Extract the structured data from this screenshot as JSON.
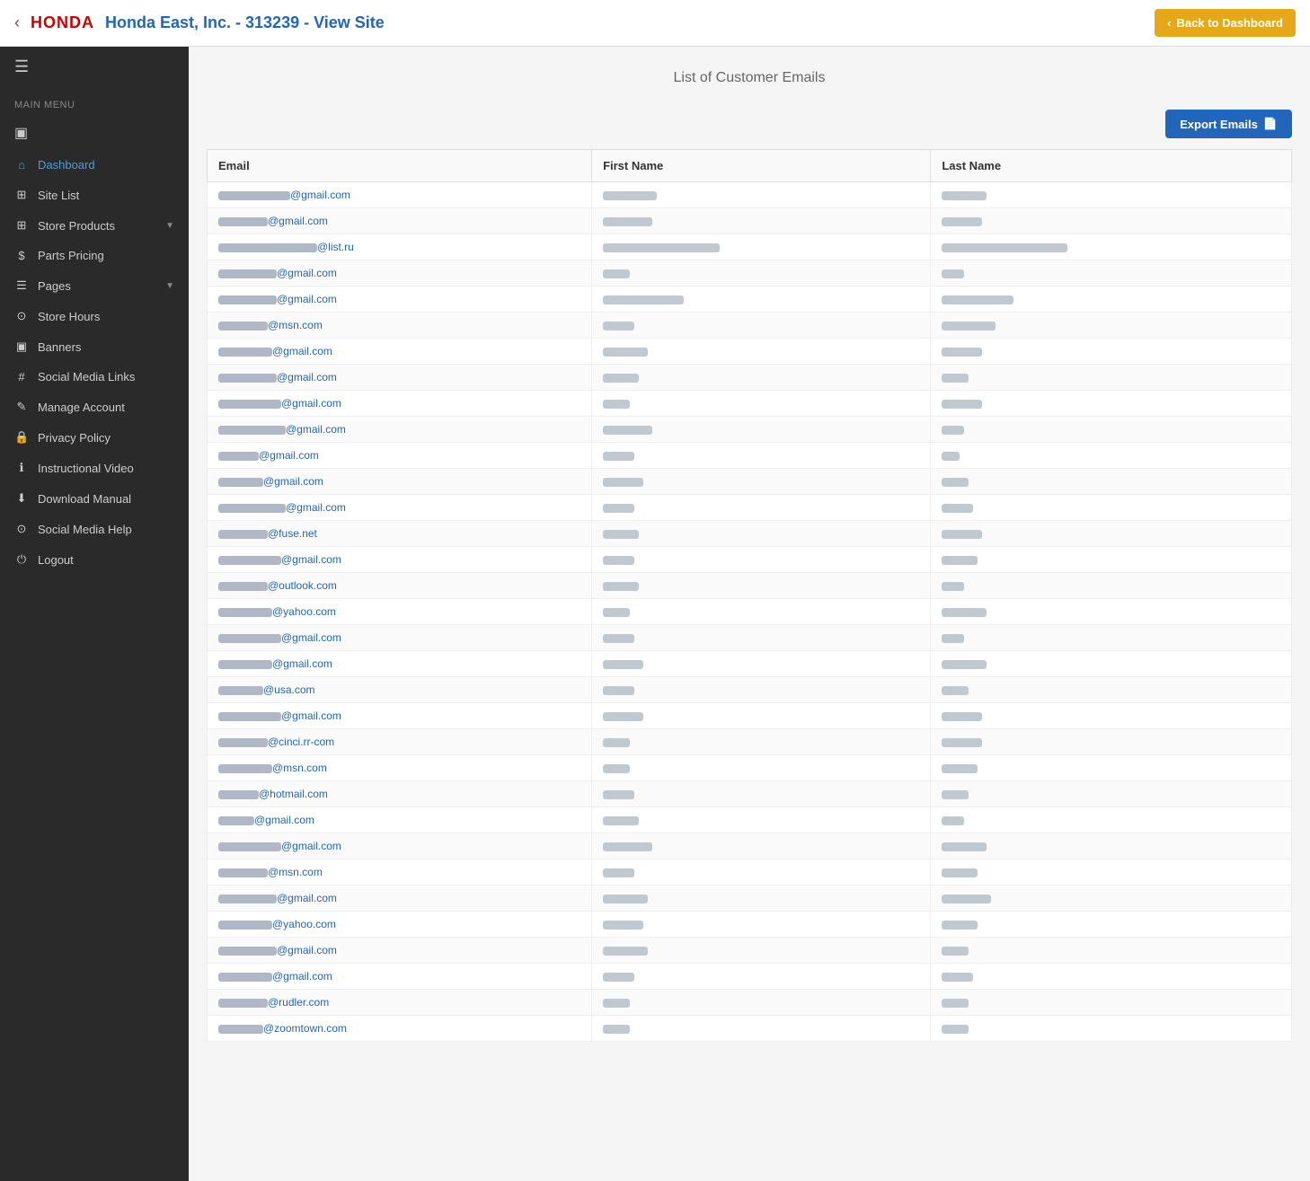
{
  "header": {
    "close_label": "‹",
    "honda_label": "HONDA",
    "site_title": "Honda East, Inc. - 313239 - View Site",
    "back_button": "Back to Dashboard"
  },
  "sidebar": {
    "menu_label": "Main Menu",
    "hamburger_icon": "☰",
    "monitor_icon": "▣",
    "items": [
      {
        "id": "dashboard",
        "label": "Dashboard",
        "icon": "⌂",
        "active": true
      },
      {
        "id": "site-list",
        "label": "Site List",
        "icon": "⊞",
        "active": false
      },
      {
        "id": "store-products",
        "label": "Store Products",
        "icon": "⊞",
        "active": false,
        "chevron": true
      },
      {
        "id": "parts-pricing",
        "label": "Parts Pricing",
        "icon": "$",
        "active": false
      },
      {
        "id": "pages",
        "label": "Pages",
        "icon": "☰",
        "active": false,
        "chevron": true
      },
      {
        "id": "store-hours",
        "label": "Store Hours",
        "icon": "⊙",
        "active": false
      },
      {
        "id": "banners",
        "label": "Banners",
        "icon": "▣",
        "active": false
      },
      {
        "id": "social-media-links",
        "label": "Social Media Links",
        "icon": "#",
        "active": false
      },
      {
        "id": "manage-account",
        "label": "Manage Account",
        "icon": "✎",
        "active": false
      },
      {
        "id": "privacy-policy",
        "label": "Privacy Policy",
        "icon": "🔒",
        "active": false
      },
      {
        "id": "instructional-video",
        "label": "Instructional Video",
        "icon": "ℹ",
        "active": false
      },
      {
        "id": "download-manual",
        "label": "Download Manual",
        "icon": "⬇",
        "active": false
      },
      {
        "id": "social-media-help",
        "label": "Social Media Help",
        "icon": "⊙",
        "active": false
      },
      {
        "id": "logout",
        "label": "Logout",
        "icon": "⏻",
        "active": false
      }
    ]
  },
  "main": {
    "page_title": "List of Customer Emails",
    "export_button": "Export Emails",
    "table": {
      "columns": [
        "Email",
        "First Name",
        "Last Name"
      ],
      "rows": [
        {
          "email": "@gmail.com",
          "email_prefix_width": "80",
          "first_name_width": "60",
          "last_name_width": "50"
        },
        {
          "email": "@gmail.com",
          "email_prefix_width": "55",
          "first_name_width": "55",
          "last_name_width": "45"
        },
        {
          "email": "@list.ru",
          "email_prefix_width": "110",
          "first_name_width": "130",
          "last_name_width": "140"
        },
        {
          "email": "@gmail.com",
          "email_prefix_width": "65",
          "first_name_width": "30",
          "last_name_width": "25"
        },
        {
          "email": "@gmail.com",
          "email_prefix_width": "65",
          "first_name_width": "90",
          "last_name_width": "80"
        },
        {
          "email": "@msn.com",
          "email_prefix_width": "55",
          "first_name_width": "35",
          "last_name_width": "60"
        },
        {
          "email": "@gmail.com",
          "email_prefix_width": "60",
          "first_name_width": "50",
          "last_name_width": "45"
        },
        {
          "email": "@gmail.com",
          "email_prefix_width": "65",
          "first_name_width": "40",
          "last_name_width": "30"
        },
        {
          "email": "@gmail.com",
          "email_prefix_width": "70",
          "first_name_width": "30",
          "last_name_width": "45"
        },
        {
          "email": "@gmail.com",
          "email_prefix_width": "75",
          "first_name_width": "55",
          "last_name_width": "25"
        },
        {
          "email": "@gmail.com",
          "email_prefix_width": "45",
          "first_name_width": "35",
          "last_name_width": "20"
        },
        {
          "email": "@gmail.com",
          "email_prefix_width": "50",
          "first_name_width": "45",
          "last_name_width": "30"
        },
        {
          "email": "@gmail.com",
          "email_prefix_width": "75",
          "first_name_width": "35",
          "last_name_width": "35"
        },
        {
          "email": "@fuse.net",
          "email_prefix_width": "55",
          "first_name_width": "40",
          "last_name_width": "45"
        },
        {
          "email": "@gmail.com",
          "email_prefix_width": "70",
          "first_name_width": "35",
          "last_name_width": "40"
        },
        {
          "email": "@outlook.com",
          "email_prefix_width": "55",
          "first_name_width": "40",
          "last_name_width": "25"
        },
        {
          "email": "@yahoo.com",
          "email_prefix_width": "60",
          "first_name_width": "30",
          "last_name_width": "50"
        },
        {
          "email": "@gmail.com",
          "email_prefix_width": "70",
          "first_name_width": "35",
          "last_name_width": "25"
        },
        {
          "email": "@gmail.com",
          "email_prefix_width": "60",
          "first_name_width": "45",
          "last_name_width": "50"
        },
        {
          "email": "@usa.com",
          "email_prefix_width": "50",
          "first_name_width": "35",
          "last_name_width": "30"
        },
        {
          "email": "@gmail.com",
          "email_prefix_width": "70",
          "first_name_width": "45",
          "last_name_width": "45"
        },
        {
          "email": "@cinci.rr-com",
          "email_prefix_width": "55",
          "first_name_width": "30",
          "last_name_width": "45"
        },
        {
          "email": "@msn.com",
          "email_prefix_width": "60",
          "first_name_width": "30",
          "last_name_width": "40"
        },
        {
          "email": "@hotmail.com",
          "email_prefix_width": "45",
          "first_name_width": "35",
          "last_name_width": "30"
        },
        {
          "email": "@gmail.com",
          "email_prefix_width": "40",
          "first_name_width": "40",
          "last_name_width": "25"
        },
        {
          "email": "@gmail.com",
          "email_prefix_width": "70",
          "first_name_width": "55",
          "last_name_width": "50"
        },
        {
          "email": "@msn.com",
          "email_prefix_width": "55",
          "first_name_width": "35",
          "last_name_width": "40"
        },
        {
          "email": "@gmail.com",
          "email_prefix_width": "65",
          "first_name_width": "50",
          "last_name_width": "55"
        },
        {
          "email": "@yahoo.com",
          "email_prefix_width": "60",
          "first_name_width": "45",
          "last_name_width": "40"
        },
        {
          "email": "@gmail.com",
          "email_prefix_width": "65",
          "first_name_width": "50",
          "last_name_width": "30"
        },
        {
          "email": "@gmail.com",
          "email_prefix_width": "60",
          "first_name_width": "35",
          "last_name_width": "35"
        },
        {
          "email": "@rudler.com",
          "email_prefix_width": "55",
          "first_name_width": "30",
          "last_name_width": "30"
        },
        {
          "email": "@zoomtown.com",
          "email_prefix_width": "50",
          "first_name_width": "30",
          "last_name_width": "30"
        }
      ]
    }
  }
}
